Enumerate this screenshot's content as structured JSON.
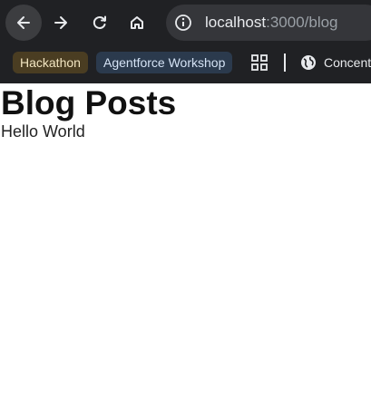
{
  "browser": {
    "url_host": "localhost",
    "url_rest": ":3000/blog",
    "bookmarks": [
      {
        "label": "Hackathon"
      },
      {
        "label": "Agentforce Workshop"
      },
      {
        "label": "Concent"
      }
    ],
    "icons": {
      "back": "back-arrow-icon",
      "forward": "forward-arrow-icon",
      "reload": "reload-icon",
      "home": "home-icon",
      "info": "info-icon",
      "apps": "apps-grid-icon",
      "globe": "globe-icon"
    },
    "colors": {
      "chrome_bg": "#202124",
      "omnibox_bg": "#35363a"
    }
  },
  "page": {
    "title": "Blog Posts",
    "text": "Hello World"
  }
}
